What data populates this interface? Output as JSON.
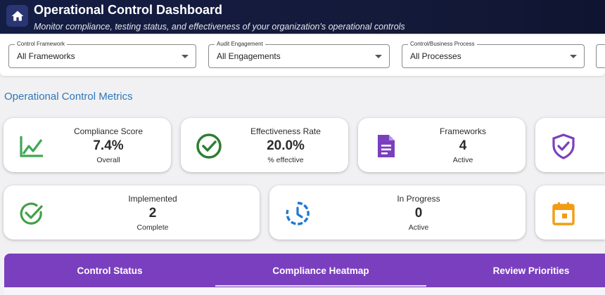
{
  "header": {
    "title": "Operational Control Dashboard",
    "subtitle": "Monitor compliance, testing status, and effectiveness of your organization's operational controls",
    "home_icon": "home-icon"
  },
  "filters": [
    {
      "label": "Control Framework",
      "value": "All Frameworks"
    },
    {
      "label": "Audit Engagement",
      "value": "All Engagements"
    },
    {
      "label": "Control/Business Process",
      "value": "All Processes"
    },
    {
      "label": "",
      "value": ""
    }
  ],
  "metrics_title": "Operational Control Metrics",
  "row1": [
    {
      "label": "Compliance Score",
      "value": "7.4%",
      "sub": "Overall",
      "icon": "trending-up-icon",
      "color": "#3fa856"
    },
    {
      "label": "Effectiveness Rate",
      "value": "20.0%",
      "sub": "% effective",
      "icon": "check-circle-icon",
      "color": "#2e7d32"
    },
    {
      "label": "Frameworks",
      "value": "4",
      "sub": "Active",
      "icon": "document-icon",
      "color": "#7b3fbe"
    },
    {
      "label": "",
      "value": "",
      "sub": "",
      "icon": "shield-check-icon",
      "color": "#7b3fbe"
    }
  ],
  "row2": [
    {
      "label": "Implemented",
      "value": "2",
      "sub": "Complete",
      "icon": "check-circle-outline-icon",
      "color": "#43a047"
    },
    {
      "label": "In Progress",
      "value": "0",
      "sub": "Active",
      "icon": "clock-icon",
      "color": "#1e78d4"
    },
    {
      "label": "",
      "value": "",
      "sub": "",
      "icon": "calendar-icon",
      "color": "#f39c12"
    }
  ],
  "tabs": [
    {
      "label": "Control Status"
    },
    {
      "label": "Compliance Heatmap",
      "active": true
    },
    {
      "label": "Review Priorities"
    }
  ]
}
